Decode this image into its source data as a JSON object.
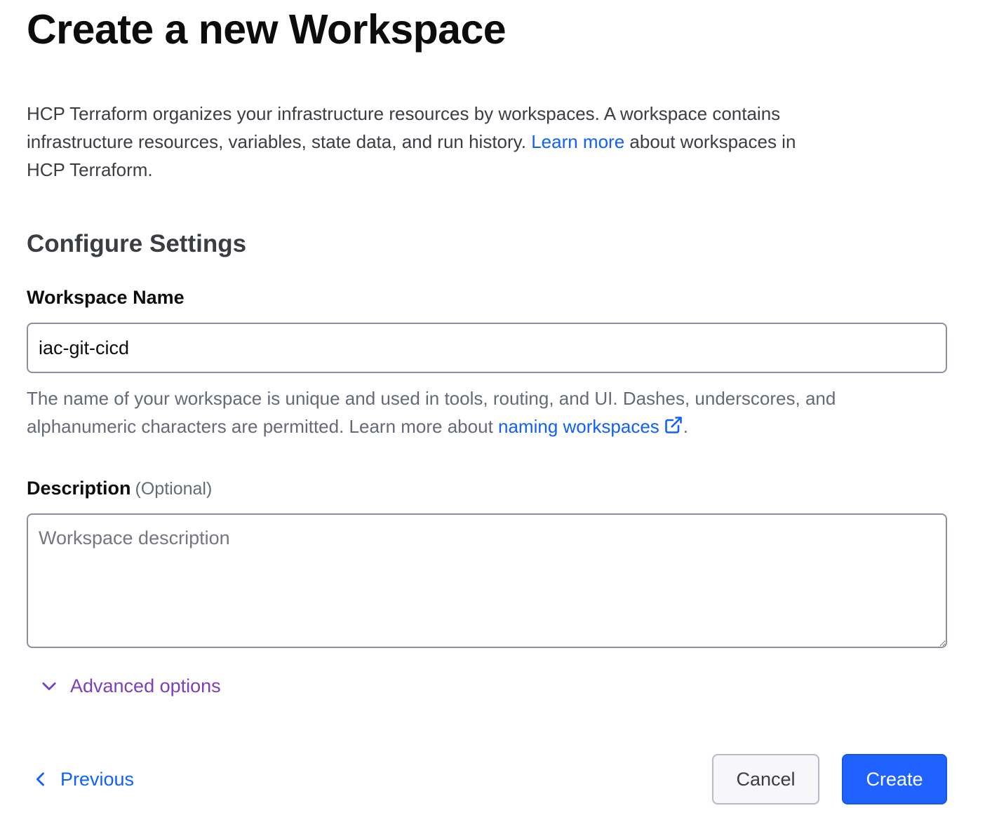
{
  "page": {
    "title": "Create a new Workspace"
  },
  "intro": {
    "text": "HCP Terraform organizes your infrastructure resources by workspaces. A workspace contains infrastructure resources, variables, state data, and run history. ",
    "link_text": "Learn more",
    "text_after": " about workspaces in HCP Terraform."
  },
  "settings": {
    "title": "Configure Settings",
    "name_field": {
      "label": "Workspace Name",
      "value": "iac-git-cicd",
      "helper_text": "The name of your workspace is unique and used in tools, routing, and UI. Dashes, underscores, and alphanumeric characters are permitted. Learn more about ",
      "helper_link_text": "naming workspaces",
      "helper_text_after": ".",
      "helper_link_icon": "external-link-icon"
    },
    "description_field": {
      "label": "Description",
      "optional_label": "(Optional)",
      "value": "",
      "placeholder": "Workspace description"
    },
    "advanced_toggle": {
      "label": "Advanced options",
      "icon": "chevron-down-icon"
    }
  },
  "footer": {
    "previous_label": "Previous",
    "previous_icon": "chevron-left-icon",
    "cancel_label": "Cancel",
    "create_label": "Create"
  },
  "colors": {
    "link": "#1060ff",
    "advanced": "#7b3fbf",
    "primary_button": "#1f62ff"
  }
}
